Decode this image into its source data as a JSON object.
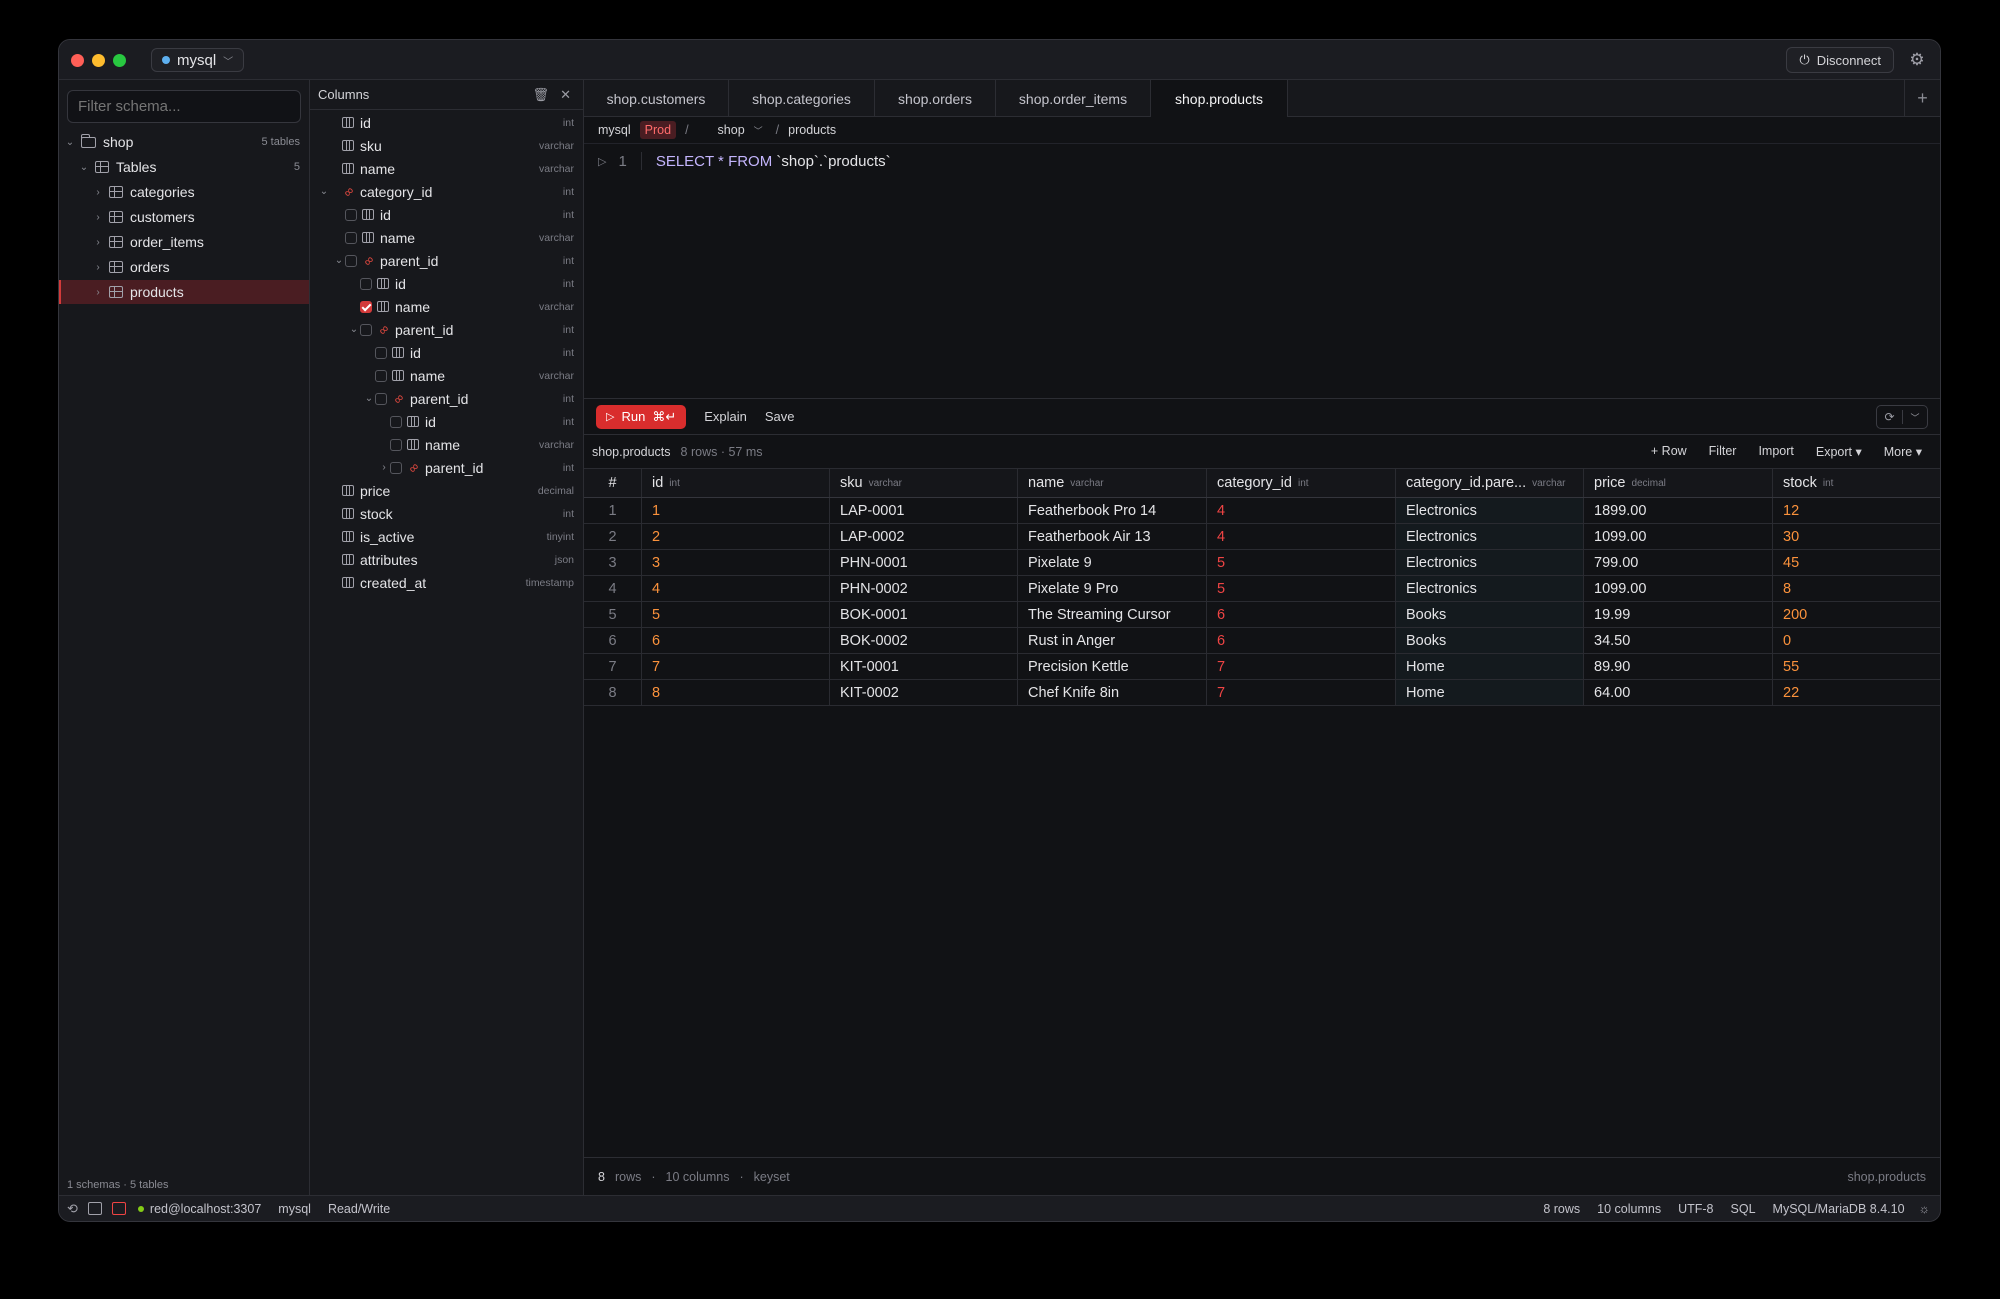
{
  "titlebar": {
    "db": "mysql",
    "disconnect": "Disconnect"
  },
  "schema": {
    "filter_placeholder": "Filter schema...",
    "db_name": "shop",
    "db_count": "5 tables",
    "group": "Tables",
    "group_count": "5",
    "tables": [
      "categories",
      "customers",
      "order_items",
      "orders",
      "products"
    ],
    "selected": "products",
    "footer": "1 schemas · 5 tables"
  },
  "columns_panel": {
    "title": "Columns",
    "rows": [
      {
        "indent": 0,
        "chev": "",
        "cb": "none",
        "icon": "col",
        "name": "id",
        "type": "int"
      },
      {
        "indent": 0,
        "chev": "",
        "cb": "none",
        "icon": "col",
        "name": "sku",
        "type": "varchar"
      },
      {
        "indent": 0,
        "chev": "",
        "cb": "none",
        "icon": "col",
        "name": "name",
        "type": "varchar"
      },
      {
        "indent": 0,
        "chev": "v",
        "cb": "none",
        "icon": "link",
        "name": "category_id",
        "type": "int"
      },
      {
        "indent": 1,
        "chev": "",
        "cb": "off",
        "icon": "col",
        "name": "id",
        "type": "int"
      },
      {
        "indent": 1,
        "chev": "",
        "cb": "off",
        "icon": "col",
        "name": "name",
        "type": "varchar"
      },
      {
        "indent": 1,
        "chev": "v",
        "cb": "off",
        "icon": "link",
        "name": "parent_id",
        "type": "int"
      },
      {
        "indent": 2,
        "chev": "",
        "cb": "off",
        "icon": "col",
        "name": "id",
        "type": "int"
      },
      {
        "indent": 2,
        "chev": "",
        "cb": "on",
        "icon": "col",
        "name": "name",
        "type": "varchar"
      },
      {
        "indent": 2,
        "chev": "v",
        "cb": "off",
        "icon": "link",
        "name": "parent_id",
        "type": "int"
      },
      {
        "indent": 3,
        "chev": "",
        "cb": "off",
        "icon": "col",
        "name": "id",
        "type": "int"
      },
      {
        "indent": 3,
        "chev": "",
        "cb": "off",
        "icon": "col",
        "name": "name",
        "type": "varchar"
      },
      {
        "indent": 3,
        "chev": "v",
        "cb": "off",
        "icon": "link",
        "name": "parent_id",
        "type": "int"
      },
      {
        "indent": 4,
        "chev": "",
        "cb": "off",
        "icon": "col",
        "name": "id",
        "type": "int"
      },
      {
        "indent": 4,
        "chev": "",
        "cb": "off",
        "icon": "col",
        "name": "name",
        "type": "varchar"
      },
      {
        "indent": 4,
        "chev": ">",
        "cb": "off",
        "icon": "link",
        "name": "parent_id",
        "type": "int"
      },
      {
        "indent": 0,
        "chev": "",
        "cb": "none",
        "icon": "col",
        "name": "price",
        "type": "decimal"
      },
      {
        "indent": 0,
        "chev": "",
        "cb": "none",
        "icon": "col",
        "name": "stock",
        "type": "int"
      },
      {
        "indent": 0,
        "chev": "",
        "cb": "none",
        "icon": "col",
        "name": "is_active",
        "type": "tinyint"
      },
      {
        "indent": 0,
        "chev": "",
        "cb": "none",
        "icon": "col",
        "name": "attributes",
        "type": "json"
      },
      {
        "indent": 0,
        "chev": "",
        "cb": "none",
        "icon": "col",
        "name": "created_at",
        "type": "timestamp"
      }
    ]
  },
  "tabs": [
    {
      "label": "shop.customers",
      "w": 145
    },
    {
      "label": "shop.categories",
      "w": 146
    },
    {
      "label": "shop.orders",
      "w": 121
    },
    {
      "label": "shop.order_items",
      "w": 155
    },
    {
      "label": "shop.products",
      "w": 137,
      "active": true
    }
  ],
  "breadcrumb": {
    "conn": "mysql",
    "env": "Prod",
    "sep": "/",
    "schema": "shop",
    "table": "products"
  },
  "editor": {
    "line": "1",
    "sql_kw1": "SELECT * FROM",
    "sql_rest": "`shop`.`products`"
  },
  "toolbar": {
    "run": "Run",
    "shortcut": "⌘↵",
    "explain": "Explain",
    "save": "Save"
  },
  "result_info": {
    "table": "shop.products",
    "meta": "8 rows · 57 ms",
    "actions": [
      "+ Row",
      "Filter",
      "Import",
      "Export ▾",
      "More ▾"
    ]
  },
  "grid": {
    "columns": [
      {
        "name": "#",
        "type": ""
      },
      {
        "name": "id",
        "type": "int"
      },
      {
        "name": "sku",
        "type": "varchar"
      },
      {
        "name": "name",
        "type": "varchar"
      },
      {
        "name": "category_id",
        "type": "int"
      },
      {
        "name": "category_id.pare...",
        "type": "varchar"
      },
      {
        "name": "price",
        "type": "decimal"
      },
      {
        "name": "stock",
        "type": "int"
      }
    ],
    "rows": [
      [
        "1",
        "1",
        "LAP-0001",
        "Featherbook Pro 14",
        "4",
        "Electronics",
        "1899.00",
        "12"
      ],
      [
        "2",
        "2",
        "LAP-0002",
        "Featherbook Air 13",
        "4",
        "Electronics",
        "1099.00",
        "30"
      ],
      [
        "3",
        "3",
        "PHN-0001",
        "Pixelate 9",
        "5",
        "Electronics",
        "799.00",
        "45"
      ],
      [
        "4",
        "4",
        "PHN-0002",
        "Pixelate 9 Pro",
        "5",
        "Electronics",
        "1099.00",
        "8"
      ],
      [
        "5",
        "5",
        "BOK-0001",
        "The Streaming Cursor",
        "6",
        "Books",
        "19.99",
        "200"
      ],
      [
        "6",
        "6",
        "BOK-0002",
        "Rust in Anger",
        "6",
        "Books",
        "34.50",
        "0"
      ],
      [
        "7",
        "7",
        "KIT-0001",
        "Precision Kettle",
        "7",
        "Home",
        "89.90",
        "55"
      ],
      [
        "8",
        "8",
        "KIT-0002",
        "Chef Knife 8in",
        "7",
        "Home",
        "64.00",
        "22"
      ]
    ]
  },
  "result_footer": {
    "rows_n": "8",
    "rows_l": "rows",
    "cols": "10 columns",
    "mode": "keyset",
    "table": "shop.products"
  },
  "statusbar": {
    "conn": "red@localhost:3307",
    "db": "mysql",
    "mode": "Read/Write",
    "rows": "8 rows",
    "cols": "10 columns",
    "enc": "UTF-8",
    "lang": "SQL",
    "server": "MySQL/MariaDB 8.4.10"
  },
  "colors": {
    "accent": "#d92d2d",
    "fk": "#ef4444",
    "number": "#fb923c"
  }
}
